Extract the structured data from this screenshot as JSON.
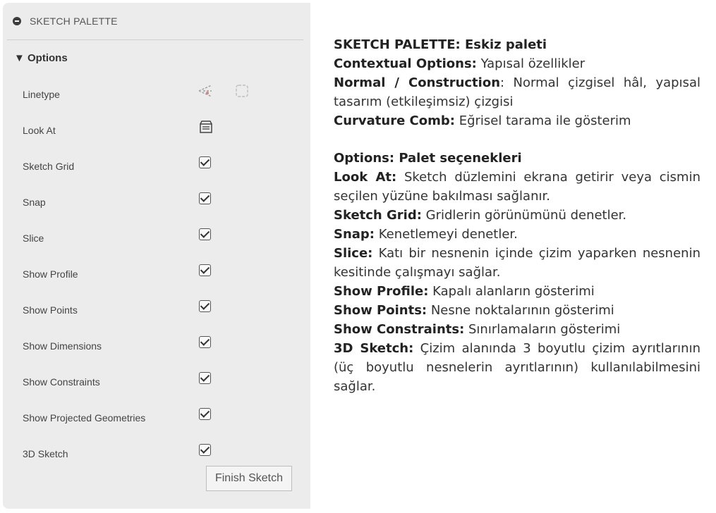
{
  "palette": {
    "title": "SKETCH PALETTE",
    "options_label": "▼ Options",
    "rows": [
      {
        "label": "Linetype",
        "control": "linetype-icons"
      },
      {
        "label": "Look At",
        "control": "look-at-icon"
      },
      {
        "label": "Sketch Grid",
        "control": "checkbox",
        "checked": true
      },
      {
        "label": "Snap",
        "control": "checkbox",
        "checked": true
      },
      {
        "label": "Slice",
        "control": "checkbox",
        "checked": true
      },
      {
        "label": "Show Profile",
        "control": "checkbox",
        "checked": true
      },
      {
        "label": "Show Points",
        "control": "checkbox",
        "checked": true
      },
      {
        "label": "Show Dimensions",
        "control": "checkbox",
        "checked": true
      },
      {
        "label": "Show Constraints",
        "control": "checkbox",
        "checked": true
      },
      {
        "label": "Show Projected Geometries",
        "control": "checkbox",
        "checked": true
      },
      {
        "label": "3D Sketch",
        "control": "checkbox",
        "checked": true
      }
    ],
    "finish_button": "Finish Sketch"
  },
  "description": {
    "items": [
      {
        "term": "SKETCH PALETTE: Eskiz paleti",
        "text": ""
      },
      {
        "term": "Contextual Options:",
        "text": " Yapısal özellikler"
      },
      {
        "term": "Normal / Construction",
        "text": ": Normal çizgisel hâl, yapısal tasarım (etkileşimsiz) çizgisi"
      },
      {
        "term": "Curvature Comb:",
        "text": " Eğrisel tarama ile gösterim"
      },
      {
        "term": "Options: Palet seçenekleri",
        "text": ""
      },
      {
        "term": "Look At:",
        "text": " Sketch düzlemini ekrana getirir veya cismin seçilen yüzüne bakılması sağlanır."
      },
      {
        "term": "Sketch Grid:",
        "text": " Gridlerin görünümünü denetler."
      },
      {
        "term": "Snap:",
        "text": " Kenetlemeyi denetler."
      },
      {
        "term": "Slice:",
        "text": " Katı bir nesnenin içinde çizim yaparken nesnenin kesitinde çalışmayı sağlar."
      },
      {
        "term": "Show Profile:",
        "text": " Kapalı alanların gösterimi"
      },
      {
        "term": "Show Points:",
        "text": " Nesne noktalarının gösterimi"
      },
      {
        "term": "Show Constraints:",
        "text": " Sınırlamaların gösterimi"
      },
      {
        "term": "3D Sketch:",
        "text": " Çizim alanında 3 boyutlu çizim ayrıtlarının (üç boyutlu nesnelerin ayrıtlarının) kullanılabilmesini sağlar."
      }
    ]
  },
  "colors": {
    "panel": "#ececec",
    "text": "#333333"
  }
}
